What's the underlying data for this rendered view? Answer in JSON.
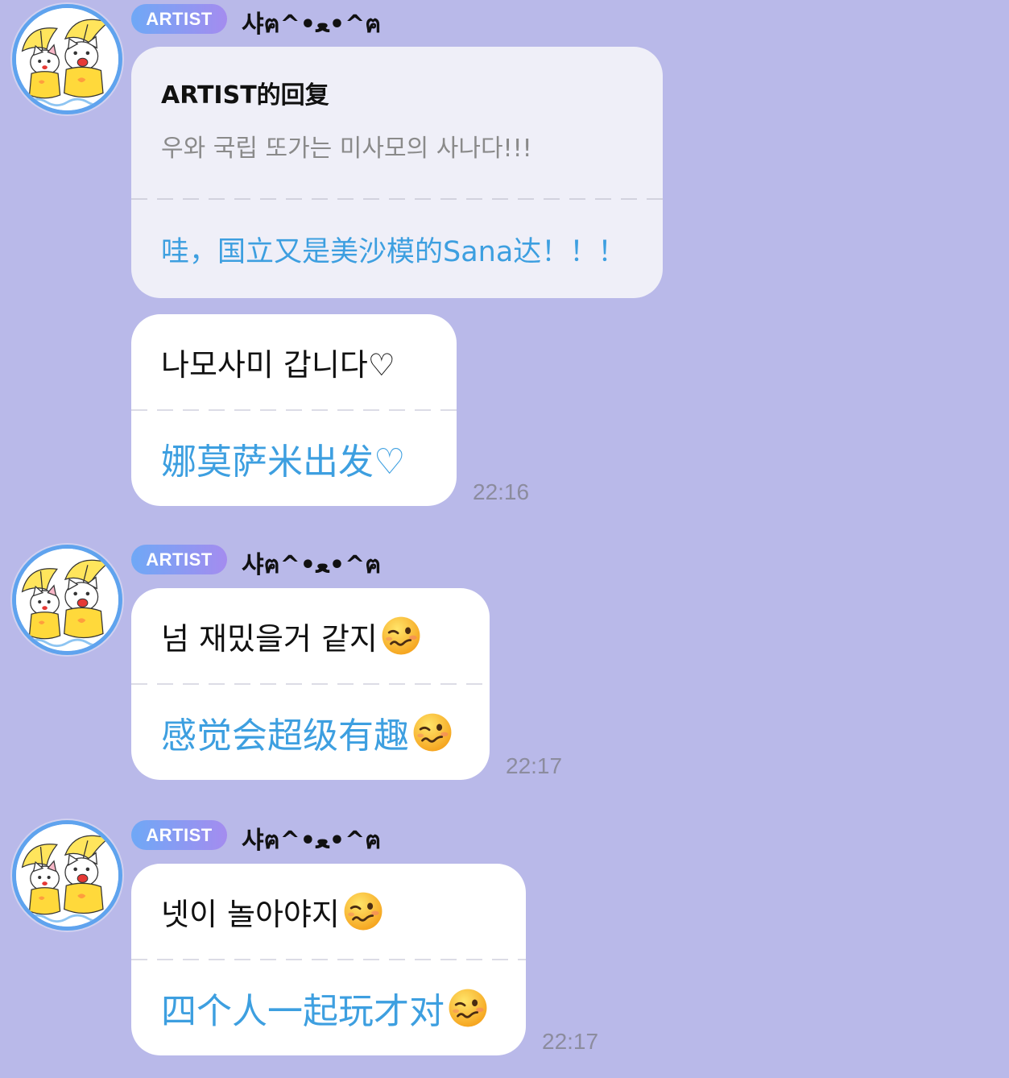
{
  "colors": {
    "background": "#b9b9e9",
    "reply_bubble": "#efeff8",
    "bubble": "#ffffff",
    "translation_text": "#3d9fe0",
    "reply_original_text": "#8a8a8a",
    "badge_gradient_start": "#6fa8f6",
    "badge_gradient_end": "#a48cef",
    "time_text": "#8c8c9e",
    "avatar_ring": "#5fa3ee"
  },
  "groups": [
    {
      "avatar_icon": "cartoon-cats-umbrella-avatar",
      "badge": "ARTIST",
      "sender": "샤ฅ^•ﻌ•^ฅ",
      "reply": {
        "header": "ARTIST的回复",
        "original": "우와 국립 또가는 미사모의 사나다!!!",
        "translation": "哇，国立又是美沙模的Sana达！！！"
      },
      "message": {
        "original": "나모사미 갑니다♡",
        "translation": "娜莫萨米出发♡",
        "time": "22:16"
      }
    },
    {
      "avatar_icon": "cartoon-cats-umbrella-avatar",
      "badge": "ARTIST",
      "sender": "샤ฅ^•ﻌ•^ฅ",
      "message": {
        "original": "넘 재밌을거 같지",
        "translation": "感觉会超级有趣",
        "emoji_icon": "woozy-face-emoji",
        "time": "22:17"
      }
    },
    {
      "avatar_icon": "cartoon-cats-umbrella-avatar",
      "badge": "ARTIST",
      "sender": "샤ฅ^•ﻌ•^ฅ",
      "message": {
        "original": "넷이 놀아야지",
        "translation": "四个人一起玩才对",
        "emoji_icon": "woozy-face-emoji",
        "time": "22:17"
      }
    }
  ]
}
